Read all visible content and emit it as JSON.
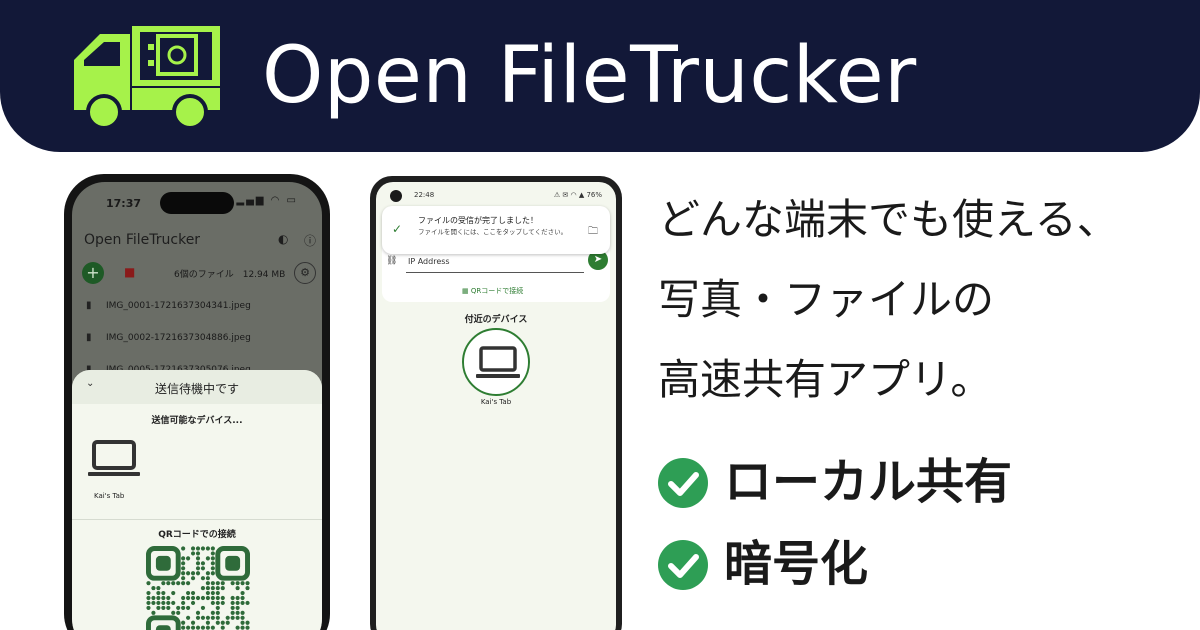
{
  "banner": {
    "title": "Open FileTrucker",
    "logo_icon": "truck-with-safe-icon",
    "background": "#121838",
    "logo_color": "#a6f24a"
  },
  "iphone": {
    "status_time": "17:37",
    "status_icons": "▂▄▆ ◠ ▭",
    "app_title": "Open FileTrucker",
    "header_icons": [
      "theme-icon",
      "info-icon"
    ],
    "add_symbol": "+",
    "file_summary": "6個のファイル　12.94 MB",
    "files": [
      "IMG_0001-1721637304341.jpeg",
      "IMG_0002-1721637304886.jpeg",
      "IMG_0005-1721637305076.jpeg"
    ],
    "sheet": {
      "title": "送信待機中です",
      "sendable_label": "送信可能なデバイス...",
      "device_name": "Kai's Tab",
      "qr_label": "QRコードでの接続"
    }
  },
  "android": {
    "status_time": "22:48",
    "status_icons": "⚠ ✉ ◠ ▲ 76%",
    "notification": {
      "title": "ファイルの受信が完了しました！",
      "body": "ファイルを開くには、ここをタップしてください。"
    },
    "ip_placeholder": "IP Address",
    "qr_button": "QRコードで接続",
    "nearby_label": "付近のデバイス",
    "device_name": "Kai's Tab",
    "accent": "#2e7d32"
  },
  "tagline": {
    "line1": "どんな端末でも使える、",
    "line2": "写真・ファイルの",
    "line3": "高速共有アプリ。"
  },
  "features": [
    {
      "label": "ローカル共有",
      "icon": "check-circle-icon"
    },
    {
      "label": "暗号化",
      "icon": "check-circle-icon"
    }
  ],
  "feature_check_color": "#2e9e55"
}
